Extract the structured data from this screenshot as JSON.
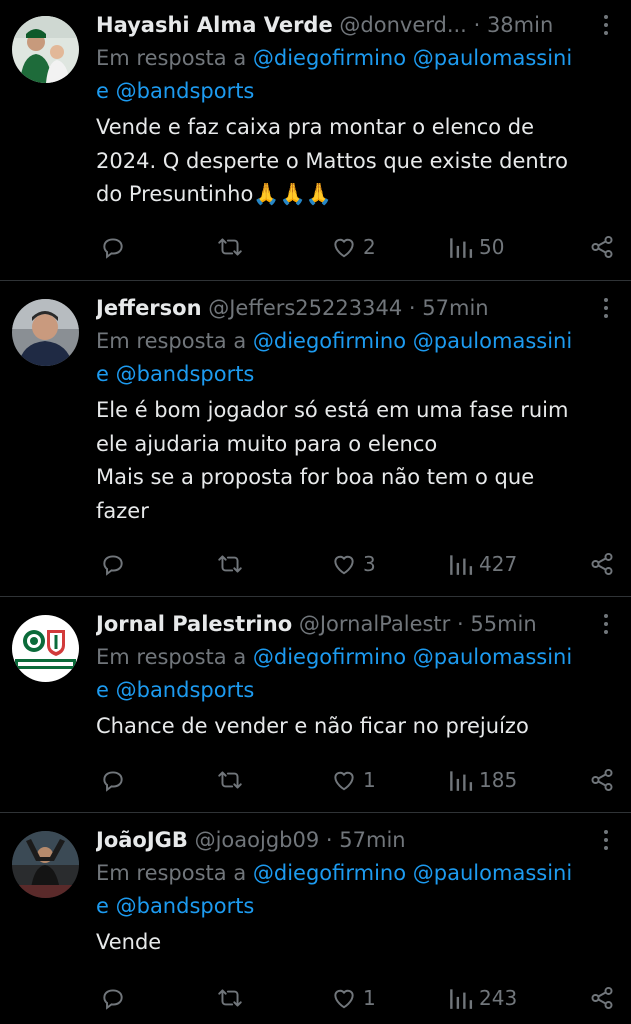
{
  "reply_prefix": "Em resposta a",
  "tweets": [
    {
      "name": "Hayashi Alma Verde",
      "handle": "@donverd...",
      "sep": "·",
      "time": "38min",
      "mentions": [
        "@diegofirmino",
        "@paulomassini",
        "@bandsports"
      ],
      "joiner": "e",
      "text": "Vende e faz caixa pra montar o elenco de\n2024. Q desperte o Mattos que existe dentro\ndo Presuntinho🙏🙏🙏",
      "likes": "2",
      "views": "50"
    },
    {
      "name": "Jefferson",
      "handle": "@Jeffers25223344",
      "sep": "·",
      "time": "57min",
      "mentions": [
        "@diegofirmino",
        "@paulomassini",
        "@bandsports"
      ],
      "joiner": "e",
      "text": "Ele é bom jogador só está em uma fase ruim\nele ajudaria muito para o elenco\nMais se a proposta for boa não tem o que\nfazer",
      "likes": "3",
      "views": "427"
    },
    {
      "name": "Jornal Palestrino",
      "handle": "@JornalPalestr",
      "sep": "·",
      "time": "55min",
      "mentions": [
        "@diegofirmino",
        "@paulomassini",
        "@bandsports"
      ],
      "joiner": "e",
      "text": "Chance de vender e não ficar no prejuízo",
      "likes": "1",
      "views": "185"
    },
    {
      "name": "JoãoJGB",
      "handle": "@joaojgb09",
      "sep": "·",
      "time": "57min",
      "mentions": [
        "@diegofirmino",
        "@paulomassini",
        "@bandsports"
      ],
      "joiner": "e",
      "text": "Vende",
      "likes": "1",
      "views": "243"
    }
  ],
  "icons": {
    "reply": "reply-icon",
    "retweet": "retweet-icon",
    "like": "heart-icon",
    "views": "views-icon",
    "share": "share-icon",
    "more": "more-options-icon"
  },
  "colors": {
    "background": "#000000",
    "text": "#e7e9ea",
    "muted": "#71767b",
    "link": "#1d9bf0",
    "divider": "#2f3336"
  }
}
